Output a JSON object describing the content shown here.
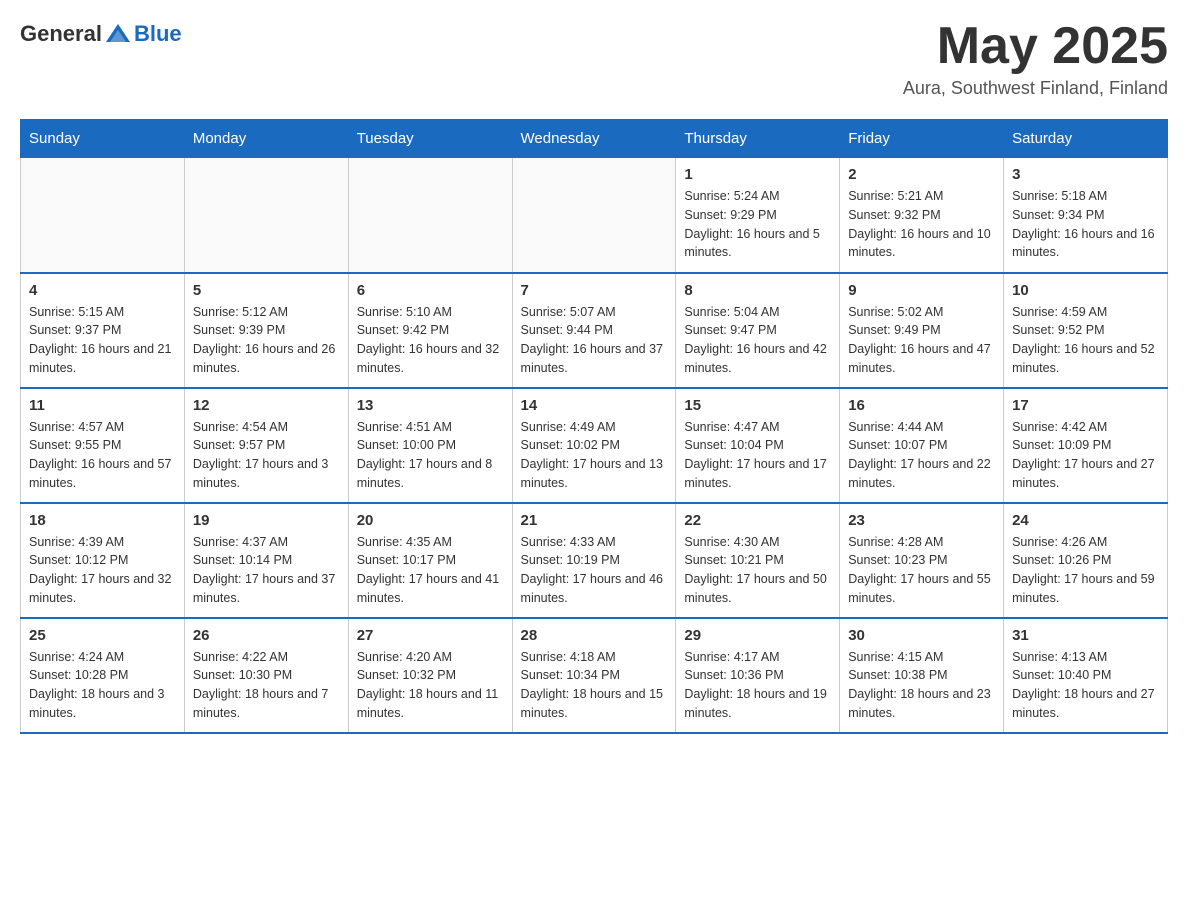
{
  "header": {
    "logo": {
      "general": "General",
      "blue": "Blue"
    },
    "title": "May 2025",
    "subtitle": "Aura, Southwest Finland, Finland"
  },
  "calendar": {
    "days_of_week": [
      "Sunday",
      "Monday",
      "Tuesday",
      "Wednesday",
      "Thursday",
      "Friday",
      "Saturday"
    ],
    "weeks": [
      [
        {
          "day": "",
          "info": ""
        },
        {
          "day": "",
          "info": ""
        },
        {
          "day": "",
          "info": ""
        },
        {
          "day": "",
          "info": ""
        },
        {
          "day": "1",
          "info": "Sunrise: 5:24 AM\nSunset: 9:29 PM\nDaylight: 16 hours and 5 minutes."
        },
        {
          "day": "2",
          "info": "Sunrise: 5:21 AM\nSunset: 9:32 PM\nDaylight: 16 hours and 10 minutes."
        },
        {
          "day": "3",
          "info": "Sunrise: 5:18 AM\nSunset: 9:34 PM\nDaylight: 16 hours and 16 minutes."
        }
      ],
      [
        {
          "day": "4",
          "info": "Sunrise: 5:15 AM\nSunset: 9:37 PM\nDaylight: 16 hours and 21 minutes."
        },
        {
          "day": "5",
          "info": "Sunrise: 5:12 AM\nSunset: 9:39 PM\nDaylight: 16 hours and 26 minutes."
        },
        {
          "day": "6",
          "info": "Sunrise: 5:10 AM\nSunset: 9:42 PM\nDaylight: 16 hours and 32 minutes."
        },
        {
          "day": "7",
          "info": "Sunrise: 5:07 AM\nSunset: 9:44 PM\nDaylight: 16 hours and 37 minutes."
        },
        {
          "day": "8",
          "info": "Sunrise: 5:04 AM\nSunset: 9:47 PM\nDaylight: 16 hours and 42 minutes."
        },
        {
          "day": "9",
          "info": "Sunrise: 5:02 AM\nSunset: 9:49 PM\nDaylight: 16 hours and 47 minutes."
        },
        {
          "day": "10",
          "info": "Sunrise: 4:59 AM\nSunset: 9:52 PM\nDaylight: 16 hours and 52 minutes."
        }
      ],
      [
        {
          "day": "11",
          "info": "Sunrise: 4:57 AM\nSunset: 9:55 PM\nDaylight: 16 hours and 57 minutes."
        },
        {
          "day": "12",
          "info": "Sunrise: 4:54 AM\nSunset: 9:57 PM\nDaylight: 17 hours and 3 minutes."
        },
        {
          "day": "13",
          "info": "Sunrise: 4:51 AM\nSunset: 10:00 PM\nDaylight: 17 hours and 8 minutes."
        },
        {
          "day": "14",
          "info": "Sunrise: 4:49 AM\nSunset: 10:02 PM\nDaylight: 17 hours and 13 minutes."
        },
        {
          "day": "15",
          "info": "Sunrise: 4:47 AM\nSunset: 10:04 PM\nDaylight: 17 hours and 17 minutes."
        },
        {
          "day": "16",
          "info": "Sunrise: 4:44 AM\nSunset: 10:07 PM\nDaylight: 17 hours and 22 minutes."
        },
        {
          "day": "17",
          "info": "Sunrise: 4:42 AM\nSunset: 10:09 PM\nDaylight: 17 hours and 27 minutes."
        }
      ],
      [
        {
          "day": "18",
          "info": "Sunrise: 4:39 AM\nSunset: 10:12 PM\nDaylight: 17 hours and 32 minutes."
        },
        {
          "day": "19",
          "info": "Sunrise: 4:37 AM\nSunset: 10:14 PM\nDaylight: 17 hours and 37 minutes."
        },
        {
          "day": "20",
          "info": "Sunrise: 4:35 AM\nSunset: 10:17 PM\nDaylight: 17 hours and 41 minutes."
        },
        {
          "day": "21",
          "info": "Sunrise: 4:33 AM\nSunset: 10:19 PM\nDaylight: 17 hours and 46 minutes."
        },
        {
          "day": "22",
          "info": "Sunrise: 4:30 AM\nSunset: 10:21 PM\nDaylight: 17 hours and 50 minutes."
        },
        {
          "day": "23",
          "info": "Sunrise: 4:28 AM\nSunset: 10:23 PM\nDaylight: 17 hours and 55 minutes."
        },
        {
          "day": "24",
          "info": "Sunrise: 4:26 AM\nSunset: 10:26 PM\nDaylight: 17 hours and 59 minutes."
        }
      ],
      [
        {
          "day": "25",
          "info": "Sunrise: 4:24 AM\nSunset: 10:28 PM\nDaylight: 18 hours and 3 minutes."
        },
        {
          "day": "26",
          "info": "Sunrise: 4:22 AM\nSunset: 10:30 PM\nDaylight: 18 hours and 7 minutes."
        },
        {
          "day": "27",
          "info": "Sunrise: 4:20 AM\nSunset: 10:32 PM\nDaylight: 18 hours and 11 minutes."
        },
        {
          "day": "28",
          "info": "Sunrise: 4:18 AM\nSunset: 10:34 PM\nDaylight: 18 hours and 15 minutes."
        },
        {
          "day": "29",
          "info": "Sunrise: 4:17 AM\nSunset: 10:36 PM\nDaylight: 18 hours and 19 minutes."
        },
        {
          "day": "30",
          "info": "Sunrise: 4:15 AM\nSunset: 10:38 PM\nDaylight: 18 hours and 23 minutes."
        },
        {
          "day": "31",
          "info": "Sunrise: 4:13 AM\nSunset: 10:40 PM\nDaylight: 18 hours and 27 minutes."
        }
      ]
    ]
  }
}
